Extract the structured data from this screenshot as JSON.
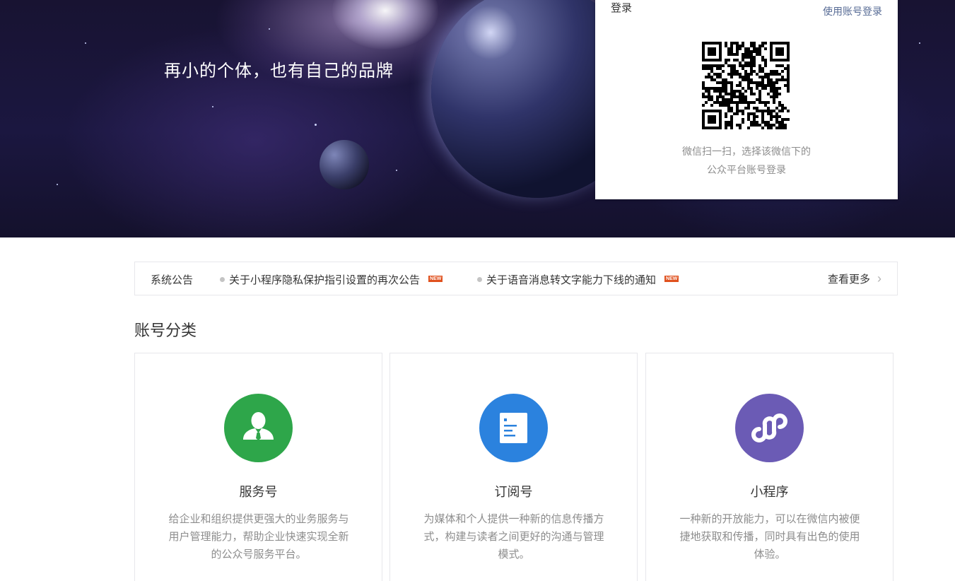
{
  "hero": {
    "slogan": "再小的个体，也有自己的品牌"
  },
  "login": {
    "title": "登录",
    "account_login_link": "使用账号登录",
    "qr_hint_line1": "微信扫一扫，选择该微信下的",
    "qr_hint_line2": "公众平台账号登录"
  },
  "notices": {
    "title": "系统公告",
    "items": [
      {
        "text": "关于小程序隐私保护指引设置的再次公告",
        "badge": "NEW"
      },
      {
        "text": "关于语音消息转文字能力下线的通知",
        "badge": "NEW"
      }
    ],
    "more": "查看更多"
  },
  "categories": {
    "title": "账号分类",
    "cards": [
      {
        "name": "服务号",
        "icon": "person-icon",
        "color": "#2ea64a",
        "desc": "给企业和组织提供更强大的业务服务与用户管理能力，帮助企业快速实现全新的公众号服务平台。"
      },
      {
        "name": "订阅号",
        "icon": "document-icon",
        "color": "#2b82de",
        "desc": "为媒体和个人提供一种新的信息传播方式，构建与读者之间更好的沟通与管理模式。"
      },
      {
        "name": "小程序",
        "icon": "mini-program-icon",
        "color": "#6b5bb5",
        "desc": "一种新的开放能力，可以在微信内被便捷地获取和传播，同时具有出色的使用体验。"
      }
    ]
  },
  "colors": {
    "link": "#576b95",
    "new_badge": "#e0511e"
  }
}
